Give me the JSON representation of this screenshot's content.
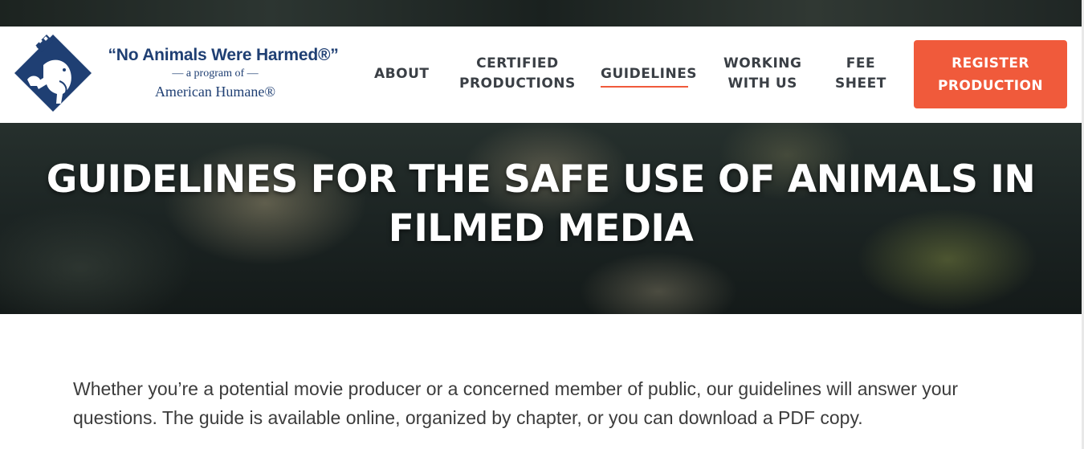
{
  "header": {
    "logo": {
      "title": "“No Animals Were Harmed®”",
      "subtitle": "— a program of —",
      "organization": "American Humane®"
    },
    "nav": [
      {
        "label_line1": "ABOUT",
        "label_line2": ""
      },
      {
        "label_line1": "CERTIFIED",
        "label_line2": "PRODUCTIONS"
      },
      {
        "label_line1": "GUIDELINES",
        "label_line2": "",
        "active": true
      },
      {
        "label_line1": "WORKING",
        "label_line2": "WITH US"
      },
      {
        "label_line1": "FEE",
        "label_line2": "SHEET"
      }
    ],
    "cta": {
      "line1": "REGISTER",
      "line2": "PRODUCTION"
    }
  },
  "hero": {
    "title": "GUIDELINES FOR THE SAFE USE OF ANIMALS IN FILMED MEDIA"
  },
  "intro": {
    "text": "Whether you’re a potential movie producer or a concerned member of public, our guidelines will answer your questions. The guide is available online, organized by chapter, or you can download a PDF copy."
  },
  "colors": {
    "brand_blue": "#1f3f73",
    "accent": "#f05a3b",
    "nav_text": "#3a3f45"
  },
  "icons": {
    "logo_mark": "film-strip-animals-icon"
  }
}
